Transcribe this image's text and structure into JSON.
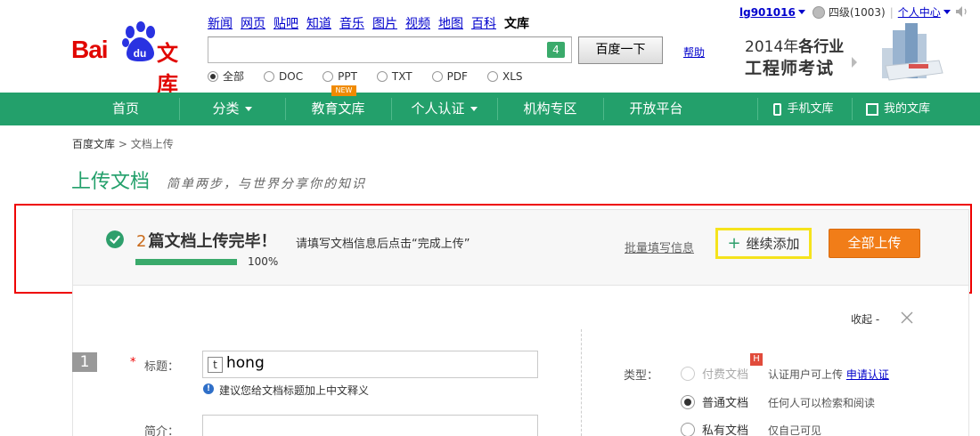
{
  "header": {
    "logo_text_bai": "Bai",
    "logo_text_du": "du",
    "logo_text_wenku": "文库",
    "nav_links": [
      "新闻",
      "网页",
      "贴吧",
      "知道",
      "音乐",
      "图片",
      "视频",
      "地图",
      "百科"
    ],
    "nav_current": "文库",
    "search_value": "",
    "search_badge": "4",
    "search_button": "百度一下",
    "help_link": "帮助",
    "doc_types": [
      {
        "label": "全部",
        "selected": true
      },
      {
        "label": "DOC",
        "selected": false
      },
      {
        "label": "PPT",
        "selected": false
      },
      {
        "label": "TXT",
        "selected": false
      },
      {
        "label": "PDF",
        "selected": false
      },
      {
        "label": "XLS",
        "selected": false
      }
    ],
    "user": {
      "name": "lg901016",
      "level": "四级(1003)",
      "separator": "|",
      "center": "个人中心"
    },
    "ad": {
      "line1_prefix": "2014年",
      "line1_bold": "各行业",
      "line2": "工程师考试"
    }
  },
  "green_nav": {
    "items": [
      "首页",
      "分类",
      "教育文库",
      "个人认证",
      "机构专区",
      "开放平台"
    ],
    "new_badge": "NEW",
    "mobile": "手机文库",
    "mine": "我的文库"
  },
  "breadcrumb": {
    "root": "百度文库",
    "sep": ">",
    "current": "文档上传"
  },
  "page": {
    "title": "上传文档",
    "subtitle": "简单两步，与世界分享你的知识"
  },
  "status": {
    "count": "2",
    "title_text": "篇文档上传完毕！",
    "hint": "请填写文档信息后点击“完成上传”",
    "progress_percent": 100,
    "progress_label": "100%",
    "batch_link": "批量填写信息",
    "add_button": "继续添加",
    "add_plus": "+",
    "upload_all_button": "全部上传"
  },
  "form": {
    "collapse": "收起",
    "collapse_arrow": "-",
    "step_number": "1",
    "required_mark": "*",
    "title_label": "标题：",
    "title_icon_text": "t",
    "title_value": "hong",
    "title_tip": "建议您给文档标题加上中文释义",
    "tip_icon_text": "!",
    "intro_label": "简介：",
    "type_label": "类型：",
    "types": [
      {
        "label": "付费文档",
        "desc": "认证用户可上传",
        "link": "申请认证",
        "selected": false,
        "disabled": true,
        "badge": "H"
      },
      {
        "label": "普通文档",
        "desc": "任何人可以检索和阅读",
        "selected": true,
        "disabled": false
      },
      {
        "label": "私有文档",
        "desc": "仅自己可见",
        "selected": false,
        "disabled": false
      }
    ]
  },
  "colors": {
    "brand_green": "#23a06b",
    "baidu_red": "#e10601",
    "upload_orange": "#f17d18",
    "highlight_red": "#ee0000",
    "highlight_yellow": "#f5e31c"
  }
}
